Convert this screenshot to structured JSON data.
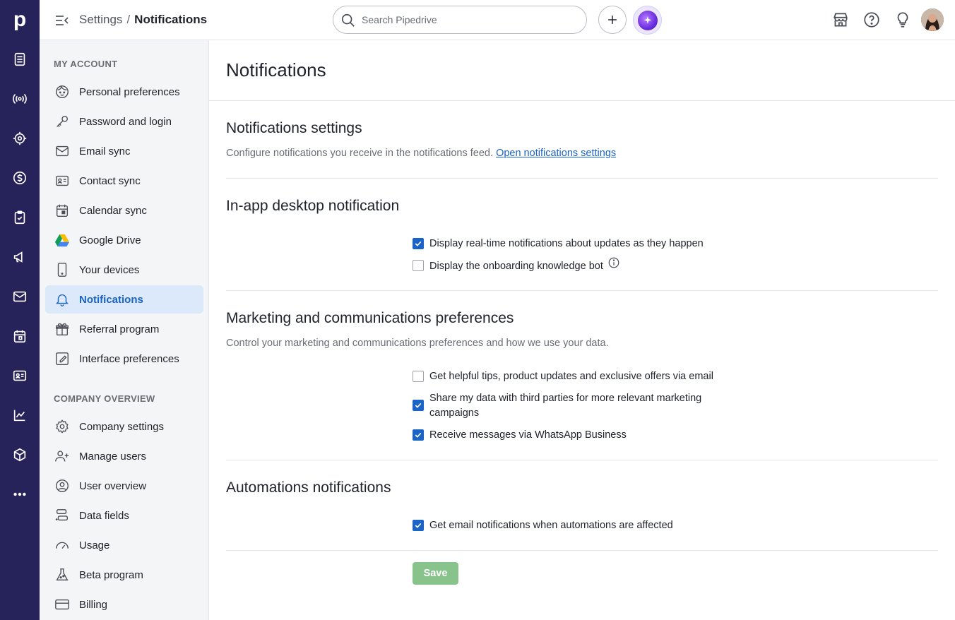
{
  "rail": {
    "logo": "p",
    "icons": [
      "leads-icon",
      "radar-icon",
      "target-icon",
      "deals-icon",
      "activities-icon",
      "campaigns-icon",
      "mail-icon",
      "calendar-icon",
      "contacts-icon",
      "insights-icon",
      "products-icon",
      "more-icon"
    ]
  },
  "header": {
    "breadcrumb_parent": "Settings",
    "breadcrumb_sep": "/",
    "breadcrumb_current": "Notifications",
    "search_placeholder": "Search Pipedrive"
  },
  "sidebar": {
    "section1": "MY ACCOUNT",
    "items1": [
      {
        "label": "Personal preferences"
      },
      {
        "label": "Password and login"
      },
      {
        "label": "Email sync"
      },
      {
        "label": "Contact sync"
      },
      {
        "label": "Calendar sync"
      },
      {
        "label": "Google Drive"
      },
      {
        "label": "Your devices"
      },
      {
        "label": "Notifications"
      },
      {
        "label": "Referral program"
      },
      {
        "label": "Interface preferences"
      }
    ],
    "section2": "COMPANY OVERVIEW",
    "items2": [
      {
        "label": "Company settings"
      },
      {
        "label": "Manage users"
      },
      {
        "label": "User overview"
      },
      {
        "label": "Data fields"
      },
      {
        "label": "Usage"
      },
      {
        "label": "Beta program"
      },
      {
        "label": "Billing"
      }
    ]
  },
  "main": {
    "title": "Notifications",
    "notif_settings": {
      "heading": "Notifications settings",
      "desc": "Configure notifications you receive in the notifications feed.",
      "link": "Open notifications settings"
    },
    "inapp": {
      "heading": "In-app desktop notification",
      "options": [
        {
          "label": "Display real-time notifications about updates as they happen",
          "checked": true
        },
        {
          "label": "Display the onboarding knowledge bot",
          "checked": false
        }
      ]
    },
    "marketing": {
      "heading": "Marketing and communications preferences",
      "desc": "Control your marketing and communications preferences and how we use your data.",
      "options": [
        {
          "label": "Get helpful tips, product updates and exclusive offers via email",
          "checked": false
        },
        {
          "label": "Share my data with third parties for more relevant marketing campaigns",
          "checked": true
        },
        {
          "label": "Receive messages via WhatsApp Business",
          "checked": true
        }
      ]
    },
    "automations": {
      "heading": "Automations notifications",
      "options": [
        {
          "label": "Get email notifications when automations are affected",
          "checked": true
        }
      ]
    },
    "save_label": "Save"
  }
}
